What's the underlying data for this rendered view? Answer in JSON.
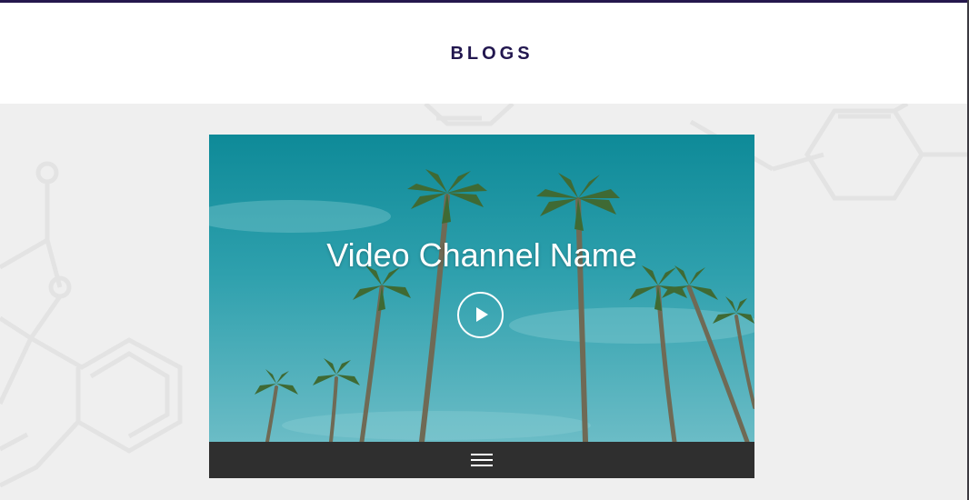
{
  "header": {
    "title": "BLOGS"
  },
  "video": {
    "channel_name": "Video Channel Name",
    "play_icon": "play-icon",
    "menu_icon": "hamburger-menu-icon"
  },
  "colors": {
    "title_color": "#22174f",
    "top_rule": "#25174d",
    "page_background": "#efefef",
    "control_bar": "#2f2f2f",
    "sky_teal": "#1f8f9c"
  }
}
